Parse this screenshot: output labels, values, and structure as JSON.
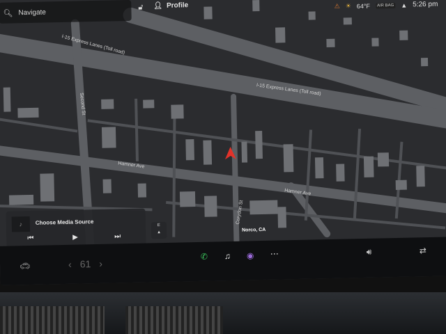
{
  "search": {
    "placeholder_label": "Navigate"
  },
  "header": {
    "profile_label": "Profile"
  },
  "status": {
    "temperature": "64°F",
    "airbag_label": "AIR BAG",
    "time": "5:26 pm"
  },
  "map": {
    "labels": {
      "road_1": "I-15 Express Lanes (Toll road)",
      "road_2": "I-15 Express Lanes (Toll road)",
      "road_3": "Second St",
      "road_4": "Hamner Ave",
      "road_5": "Hamner Ave",
      "road_6": "Corydon St",
      "place_1": "Norco, CA"
    }
  },
  "media": {
    "title": "Choose Media Source"
  },
  "compass": {
    "label": "E"
  },
  "dock": {
    "temperature_value": "61"
  },
  "colors": {
    "screen_bg": "#2b2c2f",
    "road": "#5d5f63",
    "block": "#6e7074",
    "accent_nav": "#e2322a"
  }
}
